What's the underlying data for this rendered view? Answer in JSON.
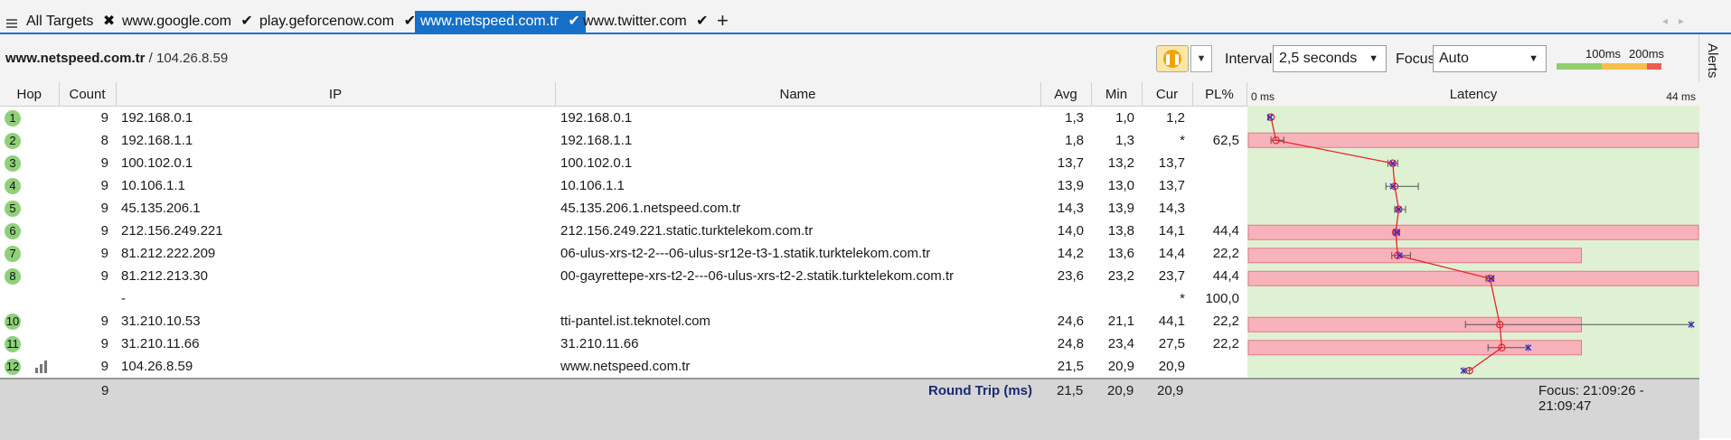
{
  "tabs": [
    {
      "label": "All Targets",
      "icon": "close-icon",
      "glyph": "✖",
      "active": false
    },
    {
      "label": "www.google.com",
      "icon": "check-icon",
      "glyph": "✔",
      "active": false
    },
    {
      "label": "play.geforcenow.com",
      "icon": "check-icon",
      "glyph": "✔",
      "active": false
    },
    {
      "label": "www.netspeed.com.tr",
      "icon": "check-icon",
      "glyph": "✔",
      "active": true
    },
    {
      "label": "www.twitter.com",
      "icon": "check-icon",
      "glyph": "✔",
      "active": false
    }
  ],
  "add_tab_glyph": "+",
  "toolbar": {
    "target_host": "www.netspeed.com.tr",
    "target_ip": "/ 104.26.8.59",
    "interval_label": "Interval",
    "interval_value": "2,5 seconds",
    "focus_label": "Focus",
    "focus_value": "Auto",
    "scale_100": "100ms",
    "scale_200": "200ms",
    "scale_colors": [
      "#8fcf6e",
      "#f7c04b",
      "#ef5b4f"
    ]
  },
  "alerts_label": "Alerts",
  "columns": {
    "hop": "Hop",
    "count": "Count",
    "ip": "IP",
    "name": "Name",
    "avg": "Avg",
    "min": "Min",
    "cur": "Cur",
    "pl": "PL%",
    "latency": "Latency"
  },
  "rows": [
    {
      "hop": "1",
      "count": "9",
      "ip": "192.168.0.1",
      "name": "192.168.0.1",
      "avg": "1,3",
      "min": "1,0",
      "cur": "1,2",
      "pl": ""
    },
    {
      "hop": "2",
      "count": "8",
      "ip": "192.168.1.1",
      "name": "192.168.1.1",
      "avg": "1,8",
      "min": "1,3",
      "cur": "*",
      "pl": "62,5"
    },
    {
      "hop": "3",
      "count": "9",
      "ip": "100.102.0.1",
      "name": "100.102.0.1",
      "avg": "13,7",
      "min": "13,2",
      "cur": "13,7",
      "pl": ""
    },
    {
      "hop": "4",
      "count": "9",
      "ip": "10.106.1.1",
      "name": "10.106.1.1",
      "avg": "13,9",
      "min": "13,0",
      "cur": "13,7",
      "pl": ""
    },
    {
      "hop": "5",
      "count": "9",
      "ip": "45.135.206.1",
      "name": "45.135.206.1.netspeed.com.tr",
      "avg": "14,3",
      "min": "13,9",
      "cur": "14,3",
      "pl": ""
    },
    {
      "hop": "6",
      "count": "9",
      "ip": "212.156.249.221",
      "name": "212.156.249.221.static.turktelekom.com.tr",
      "avg": "14,0",
      "min": "13,8",
      "cur": "14,1",
      "pl": "44,4"
    },
    {
      "hop": "7",
      "count": "9",
      "ip": "81.212.222.209",
      "name": "06-ulus-xrs-t2-2---06-ulus-sr12e-t3-1.statik.turktelekom.com.tr",
      "avg": "14,2",
      "min": "13,6",
      "cur": "14,4",
      "pl": "22,2"
    },
    {
      "hop": "8",
      "count": "9",
      "ip": "81.212.213.30",
      "name": "00-gayrettepe-xrs-t2-2---06-ulus-xrs-t2-2.statik.turktelekom.com.tr",
      "avg": "23,6",
      "min": "23,2",
      "cur": "23,7",
      "pl": "44,4"
    },
    {
      "hop": "",
      "count": "",
      "ip": "-",
      "name": "",
      "avg": "",
      "min": "",
      "cur": "*",
      "pl": "100,0"
    },
    {
      "hop": "10",
      "count": "9",
      "ip": "31.210.10.53",
      "name": "tti-pantel.ist.teknotel.com",
      "avg": "24,6",
      "min": "21,1",
      "cur": "44,1",
      "pl": "22,2"
    },
    {
      "hop": "11",
      "count": "9",
      "ip": "31.210.11.66",
      "name": "31.210.11.66",
      "avg": "24,8",
      "min": "23,4",
      "cur": "27,5",
      "pl": "22,2"
    },
    {
      "hop": "12",
      "count": "9",
      "ip": "104.26.8.59",
      "name": "www.netspeed.com.tr",
      "avg": "21,5",
      "min": "20,9",
      "cur": "20,9",
      "pl": "",
      "graph_icon": "bar-chart-icon"
    }
  ],
  "footer": {
    "count": "9",
    "label": "Round Trip (ms)",
    "avg": "21,5",
    "min": "20,9",
    "cur": "20,9",
    "focus_range": "Focus: 21:09:26 - 21:09:47"
  },
  "chart_data": {
    "type": "line",
    "title": "Latency",
    "x_min_label": "0 ms",
    "x_max_label": "44 ms",
    "xlim": [
      0,
      44
    ],
    "hops": [
      {
        "hop": 1,
        "avg": 1.3,
        "min": 1.0,
        "max": 1.3,
        "cur": 1.2,
        "pl": 0
      },
      {
        "hop": 2,
        "avg": 1.8,
        "min": 1.3,
        "max": 2.6,
        "cur": null,
        "pl": 62.5
      },
      {
        "hop": 3,
        "avg": 13.7,
        "min": 13.2,
        "max": 14.2,
        "cur": 13.7,
        "pl": 0
      },
      {
        "hop": 4,
        "avg": 13.9,
        "min": 13.0,
        "max": 16.3,
        "cur": 13.7,
        "pl": 0
      },
      {
        "hop": 5,
        "avg": 14.3,
        "min": 13.9,
        "max": 15.0,
        "cur": 14.3,
        "pl": 0
      },
      {
        "hop": 6,
        "avg": 14.0,
        "min": 13.8,
        "max": 14.4,
        "cur": 14.1,
        "pl": 44.4
      },
      {
        "hop": 7,
        "avg": 14.2,
        "min": 13.6,
        "max": 15.5,
        "cur": 14.4,
        "pl": 22.2
      },
      {
        "hop": 8,
        "avg": 23.6,
        "min": 23.2,
        "max": 24.0,
        "cur": 23.7,
        "pl": 44.4
      },
      {
        "hop": 9,
        "avg": null,
        "min": null,
        "max": null,
        "cur": null,
        "pl": 100.0
      },
      {
        "hop": 10,
        "avg": 24.6,
        "min": 21.1,
        "max": 44.1,
        "cur": 44.1,
        "pl": 22.2
      },
      {
        "hop": 11,
        "avg": 24.8,
        "min": 23.4,
        "max": 27.5,
        "cur": 27.5,
        "pl": 22.2
      },
      {
        "hop": 12,
        "avg": 21.5,
        "min": 20.9,
        "max": 21.5,
        "cur": 20.9,
        "pl": 0
      }
    ],
    "colors": {
      "bg": "#dff1d3",
      "loss": "#f7b2bb",
      "loss_border": "#e07a85",
      "line": "#e8242b",
      "cur": "#2b2bd6",
      "err": "#555555"
    }
  }
}
